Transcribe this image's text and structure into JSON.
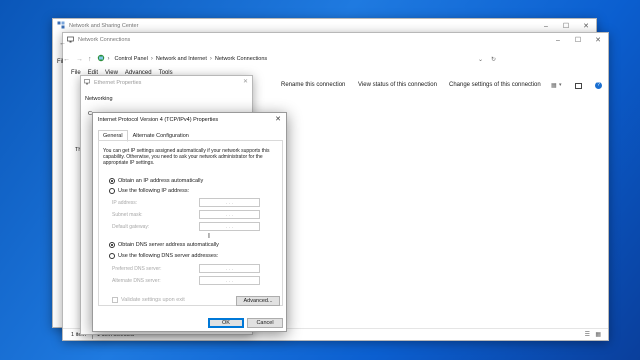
{
  "win_nsc": {
    "title": "Network and Sharing Center"
  },
  "win_nc": {
    "title": "Network Connections",
    "breadcrumb": [
      "Control Panel",
      "Network and Internet",
      "Network Connections"
    ],
    "menu": [
      "File",
      "Edit",
      "View",
      "Advanced",
      "Tools"
    ],
    "toolbar": [
      "Rename this connection",
      "View status of this connection",
      "Change settings of this connection"
    ],
    "status_items": "1 item",
    "status_selected": "1 item selected",
    "left_partial": [
      "Fil",
      "Th"
    ]
  },
  "win_eth": {
    "title": "Ethernet Properties",
    "tab": "Networking",
    "partial_label": "Conn"
  },
  "win_ipv4": {
    "title": "Internet Protocol Version 4 (TCP/IPv4) Properties",
    "tabs": [
      "General",
      "Alternate Configuration"
    ],
    "description": "You can get IP settings assigned automatically if your network supports this capability. Otherwise, you need to ask your network administrator for the appropriate IP settings.",
    "radio_ip_auto": "Obtain an IP address automatically",
    "radio_ip_manual": "Use the following IP address:",
    "ip_fields": [
      "IP address:",
      "Subnet mask:",
      "Default gateway:"
    ],
    "radio_dns_auto": "Obtain DNS server address automatically",
    "radio_dns_manual": "Use the following DNS server addresses:",
    "dns_fields": [
      "Preferred DNS server:",
      "Alternate DNS server:"
    ],
    "validate_label": "Validate settings upon exit",
    "advanced_label": "Advanced...",
    "ok_label": "OK",
    "cancel_label": "Cancel",
    "ip_dots": ". . ."
  }
}
